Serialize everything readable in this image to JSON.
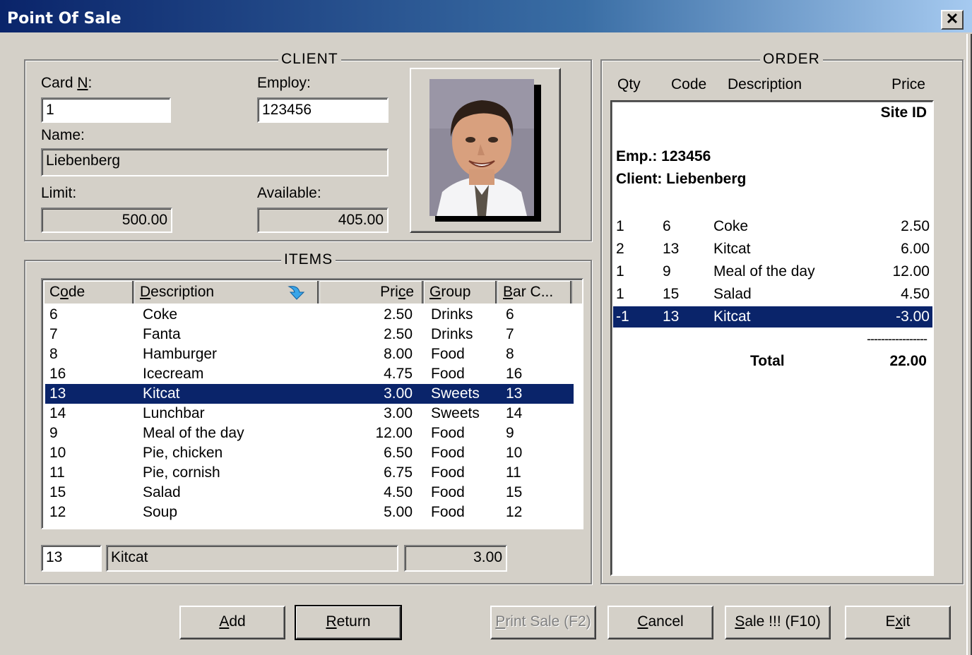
{
  "window": {
    "title": "Point Of Sale",
    "close_glyph": "✕"
  },
  "client": {
    "group_title": "CLIENT",
    "card_label_pre": "Card ",
    "card_label_acc": "N",
    "card_label_post": ":",
    "card_value": "1",
    "employ_label": "Employ:",
    "employ_value": "123456",
    "name_label": "Name:",
    "name_value": "Liebenberg",
    "limit_label": "Limit:",
    "limit_value": "500.00",
    "available_label": "Available:",
    "available_value": "405.00"
  },
  "items": {
    "group_title": "ITEMS",
    "columns": [
      {
        "pre": "C",
        "acc": "o",
        "post": "de"
      },
      {
        "pre": "",
        "acc": "D",
        "post": "escription"
      },
      {
        "pre": "Pri",
        "acc": "c",
        "post": "e"
      },
      {
        "pre": "",
        "acc": "G",
        "post": "roup"
      },
      {
        "pre": "",
        "acc": "B",
        "post": "ar C..."
      }
    ],
    "sort_icon": "sort-arrow-icon",
    "rows": [
      {
        "code": "6",
        "description": "Coke",
        "price": "2.50",
        "group": "Drinks",
        "barcode": "6"
      },
      {
        "code": "7",
        "description": "Fanta",
        "price": "2.50",
        "group": "Drinks",
        "barcode": "7"
      },
      {
        "code": "8",
        "description": "Hamburger",
        "price": "8.00",
        "group": "Food",
        "barcode": "8"
      },
      {
        "code": "16",
        "description": "Icecream",
        "price": "4.75",
        "group": "Food",
        "barcode": "16"
      },
      {
        "code": "13",
        "description": "Kitcat",
        "price": "3.00",
        "group": "Sweets",
        "barcode": "13",
        "selected": true
      },
      {
        "code": "14",
        "description": "Lunchbar",
        "price": "3.00",
        "group": "Sweets",
        "barcode": "14"
      },
      {
        "code": "9",
        "description": "Meal of the day",
        "price": "12.00",
        "group": "Food",
        "barcode": "9"
      },
      {
        "code": "10",
        "description": "Pie, chicken",
        "price": "6.50",
        "group": "Food",
        "barcode": "10"
      },
      {
        "code": "11",
        "description": "Pie, cornish",
        "price": "6.75",
        "group": "Food",
        "barcode": "11"
      },
      {
        "code": "15",
        "description": "Salad",
        "price": "4.50",
        "group": "Food",
        "barcode": "15"
      },
      {
        "code": "12",
        "description": "Soup",
        "price": "5.00",
        "group": "Food",
        "barcode": "12"
      }
    ],
    "entry_code": "13",
    "entry_description": "Kitcat",
    "entry_price": "3.00"
  },
  "order": {
    "group_title": "ORDER",
    "col_qty": "Qty",
    "col_code": "Code",
    "col_description": "Description",
    "col_price": "Price",
    "site_id": "Site ID",
    "emp_line": "Emp.: 123456",
    "client_line": "Client: Liebenberg",
    "lines": [
      {
        "qty": "1",
        "code": "6",
        "description": "Coke",
        "price": "2.50"
      },
      {
        "qty": "2",
        "code": "13",
        "description": "Kitcat",
        "price": "6.00"
      },
      {
        "qty": "1",
        "code": "9",
        "description": "Meal of the day",
        "price": "12.00"
      },
      {
        "qty": "1",
        "code": "15",
        "description": "Salad",
        "price": "4.50"
      },
      {
        "qty": "-1",
        "code": "13",
        "description": "Kitcat",
        "price": "-3.00",
        "selected": true
      }
    ],
    "separator": "-----------------",
    "total_label": "Total",
    "total_value": "22.00"
  },
  "buttons": {
    "add": {
      "pre": "",
      "acc": "A",
      "post": "dd"
    },
    "return": {
      "pre": "",
      "acc": "R",
      "post": "eturn"
    },
    "print": {
      "pre": "",
      "acc": "P",
      "post": "rint Sale (F2)"
    },
    "cancel": {
      "pre": "",
      "acc": "C",
      "post": "ancel"
    },
    "sale": {
      "pre": "",
      "acc": "S",
      "post": "ale !!! (F10)"
    },
    "exit": {
      "pre": "E",
      "acc": "x",
      "post": "it"
    }
  },
  "colors": {
    "selection": "#0a246a",
    "face": "#d4d0c8"
  }
}
